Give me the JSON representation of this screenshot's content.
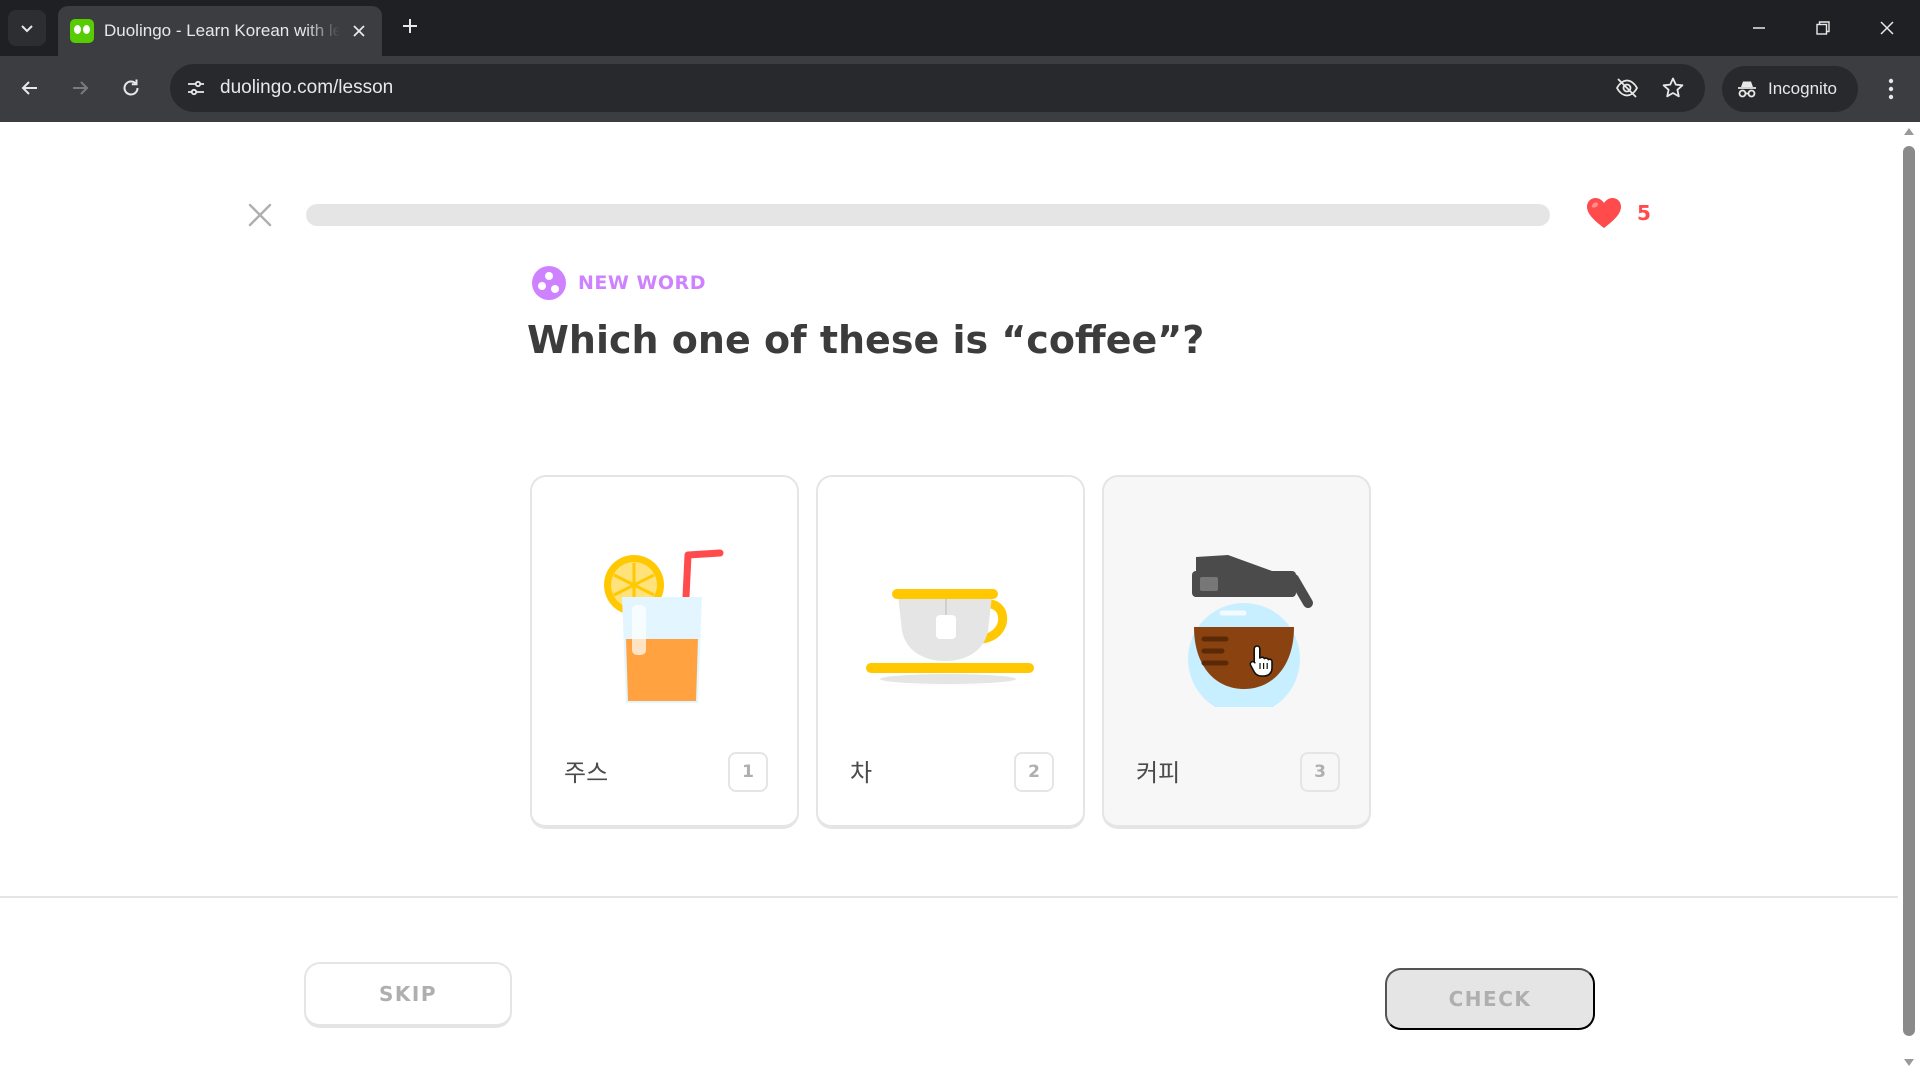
{
  "browser": {
    "tab": {
      "title": "Duolingo - Learn Korean with le",
      "favicon_icon": "duolingo-owl-icon"
    },
    "address_bar": {
      "url": "duolingo.com/lesson"
    },
    "incognito_label": "Incognito"
  },
  "lesson": {
    "progress": 0,
    "hearts": "5",
    "challenge_type_label": "NEW WORD",
    "prompt": "Which one of these is “coffee”?",
    "choices": [
      {
        "word": "주스",
        "key": "1",
        "illustration": "juice-glass-icon"
      },
      {
        "word": "차",
        "key": "2",
        "illustration": "tea-cup-icon"
      },
      {
        "word": "커피",
        "key": "3",
        "illustration": "coffee-pot-icon"
      }
    ],
    "skip_label": "SKIP",
    "check_label": "CHECK"
  },
  "colors": {
    "accent_green": "#58cc02",
    "heart_red": "#ff4b4b",
    "new_word_purple": "#ce82ff",
    "text_dark": "#3c3c3c",
    "disabled_grey": "#afafaf"
  }
}
